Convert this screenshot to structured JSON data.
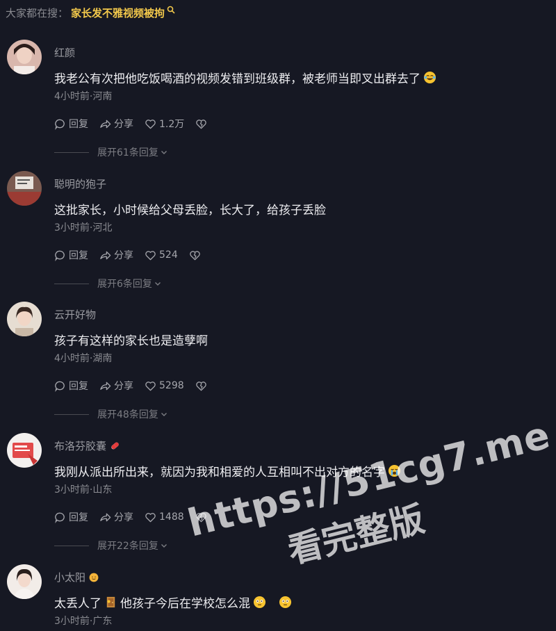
{
  "search": {
    "prefix": "大家都在搜：",
    "query": "家长发不雅视频被拘"
  },
  "comments": [
    {
      "username": "红颜",
      "text": "我老公有次把他吃饭喝酒的视频发错到班级群，被老师当即叉出群去了",
      "meta": "4小时前·河南",
      "reply_label": "回复",
      "share_label": "分享",
      "likes": "1.2万",
      "expand_label": "展开61条回复"
    },
    {
      "username": "聪明的狍子",
      "text": "这批家长，小时候给父母丢脸，长大了，给孩子丢脸",
      "meta": "3小时前·河北",
      "reply_label": "回复",
      "share_label": "分享",
      "likes": "524",
      "expand_label": "展开6条回复"
    },
    {
      "username": "云开好物",
      "text": "孩子有这样的家长也是造孽啊",
      "meta": "4小时前·湖南",
      "reply_label": "回复",
      "share_label": "分享",
      "likes": "5298",
      "expand_label": "展开48条回复"
    },
    {
      "username": "布洛芬胶囊",
      "text": "我刚从派出所出来，就因为我和相爱的人互相叫不出对方的名字",
      "meta": "3小时前·山东",
      "reply_label": "回复",
      "share_label": "分享",
      "likes": "1488",
      "expand_label": "展开22条回复"
    },
    {
      "username": "小太阳",
      "text_a": "太丢人了",
      "text_b": "他孩子今后在学校怎么混",
      "meta": "3小时前·广东"
    }
  ],
  "watermark": {
    "line1": "https://51cg7.me",
    "line2": "看完整版"
  },
  "colors": {
    "background": "#161823",
    "search_highlight": "#f2c84b",
    "muted": "#8a8b91"
  }
}
